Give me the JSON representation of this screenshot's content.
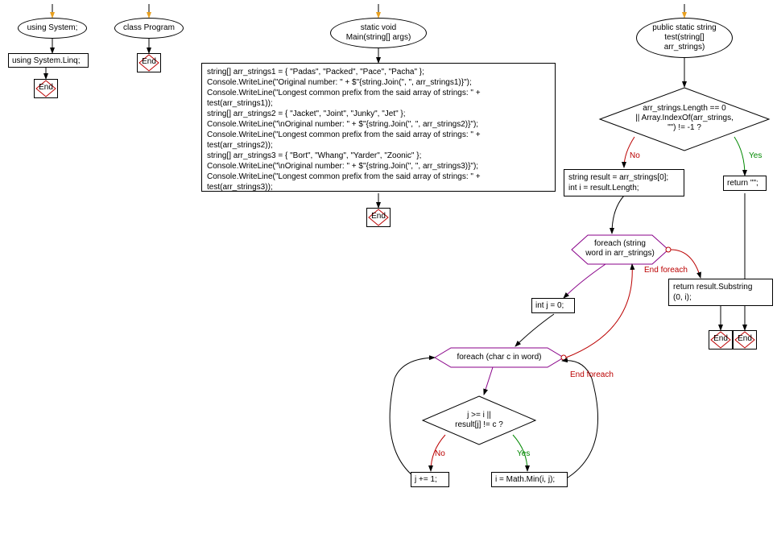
{
  "us_ellipse": "using System;",
  "us_rect": "using System.Linq;",
  "cp_ellipse": "class Program",
  "main_ellipse": "static void\nMain(string[] args)",
  "main_rect": "string[] arr_strings1 = { \"Padas\", \"Packed\", \"Pace\", \"Pacha\" };\nConsole.WriteLine(\"Original number: \" + $\"{string.Join(\", \", arr_strings1)}\");\nConsole.WriteLine(\"Longest common prefix from the said array of strings: \" +\ntest(arr_strings1));\nstring[] arr_strings2 = { \"Jacket\", \"Joint\", \"Junky\", \"Jet\" };\nConsole.WriteLine(\"\\nOriginal number: \" + $\"{string.Join(\", \", arr_strings2)}\");\nConsole.WriteLine(\"Longest common prefix from the said array of strings: \" +\ntest(arr_strings2));\nstring[] arr_strings3 = { \"Bort\", \"Whang\", \"Yarder\", \"Zoonic\" };\nConsole.WriteLine(\"\\nOriginal number: \" + $\"{string.Join(\", \", arr_strings3)}\");\nConsole.WriteLine(\"Longest common prefix from the said array of strings: \" +\ntest(arr_strings3));",
  "test_ellipse": "public static string\ntest(string[]\narr_strings)",
  "cond1": "arr_strings.Length == 0\n|| Array.IndexOf(arr_strings,\n\"\") != -1 ?",
  "return_empty": "return \"\";",
  "init_rect": "string result = arr_strings[0];\nint i = result.Length;",
  "foreach1": "foreach (string\nword in arr_strings)",
  "after_foreach": "return result.Substring\n(0, i);",
  "j0": "int j = 0;",
  "foreach2": "foreach (char c in word)",
  "cond2": "j >= i ||\nresult[j] != c ?",
  "jplus": "j += 1;",
  "imathmin": "i = Math.Min(i, j);",
  "end": "End",
  "no": "No",
  "yes": "Yes",
  "end_foreach": "End foreach"
}
